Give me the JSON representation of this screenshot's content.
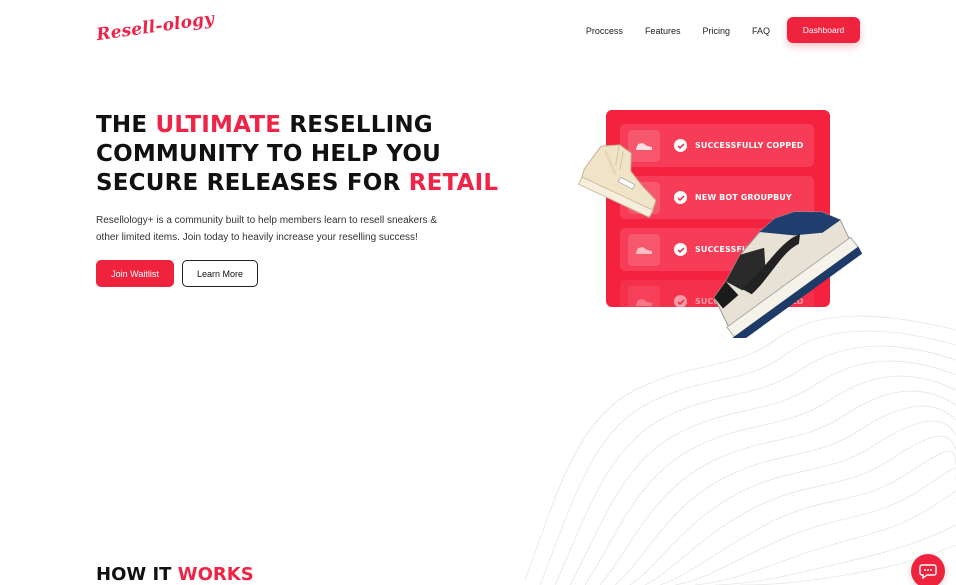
{
  "brand": {
    "logo_text": "Resell-ology",
    "accent_color": "#f0233f"
  },
  "nav": {
    "items": [
      "Proccess",
      "Features",
      "Pricing",
      "FAQ"
    ],
    "dashboard_label": "Dashboard"
  },
  "hero": {
    "title_line1_a": "THE ",
    "title_line1_accent": "ULTIMATE",
    "title_line1_b": " RESELLING",
    "title_line2": "COMMUNITY TO HELP YOU",
    "title_line3_a": "SECURE RELEASES FOR ",
    "title_line3_accent": "RETAIL",
    "description": "Resellology+ is a community built to help members learn to resell sneakers & other limited items. Join today to heavily increase your reselling success!",
    "join_label": "Join Waitlist",
    "learn_label": "Learn More"
  },
  "notifications": [
    {
      "text": "SUCCESSFULLY COPPED",
      "icon": "sneaker-thumb-icon"
    },
    {
      "text": "NEW BOT GROUPBUY",
      "icon": "bot-thumb-icon"
    },
    {
      "text": "SUCCESSFULLY",
      "icon": "sneaker-thumb-icon"
    },
    {
      "text": "SUCCESSFULLY COPPED",
      "icon": "sneaker-thumb-icon"
    }
  ],
  "section": {
    "how_a": "HOW IT ",
    "how_accent": "WORKS"
  },
  "chat": {
    "icon": "chat-bubble-icon"
  }
}
